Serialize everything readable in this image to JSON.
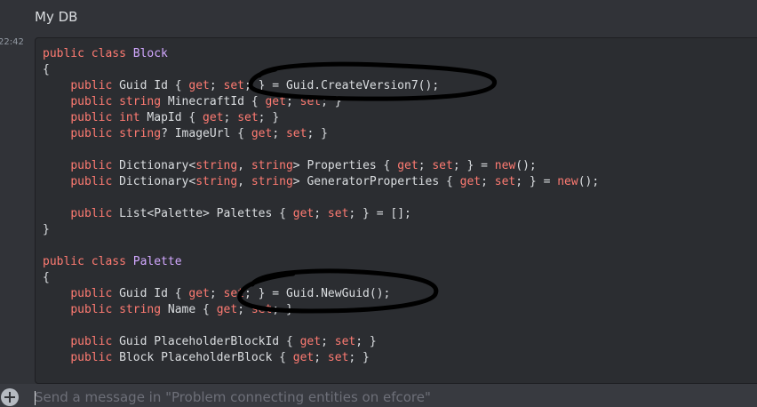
{
  "header": {
    "title": "My DB"
  },
  "message": {
    "timestamp": "22:42",
    "code_lines": [
      [
        {
          "t": "kw",
          "v": "public class "
        },
        {
          "t": "cls",
          "v": "Block"
        }
      ],
      [
        {
          "t": "plain",
          "v": "{"
        }
      ],
      [
        {
          "t": "plain",
          "v": "    "
        },
        {
          "t": "kw",
          "v": "public"
        },
        {
          "t": "plain",
          "v": " Guid Id { "
        },
        {
          "t": "kw",
          "v": "get"
        },
        {
          "t": "plain",
          "v": "; "
        },
        {
          "t": "kw",
          "v": "set"
        },
        {
          "t": "plain",
          "v": "; } = Guid.CreateVersion7();"
        }
      ],
      [
        {
          "t": "plain",
          "v": "    "
        },
        {
          "t": "kw",
          "v": "public"
        },
        {
          "t": "plain",
          "v": " "
        },
        {
          "t": "kw",
          "v": "string"
        },
        {
          "t": "plain",
          "v": " MinecraftId { "
        },
        {
          "t": "kw",
          "v": "get"
        },
        {
          "t": "plain",
          "v": "; "
        },
        {
          "t": "kw",
          "v": "set"
        },
        {
          "t": "plain",
          "v": "; }"
        }
      ],
      [
        {
          "t": "plain",
          "v": "    "
        },
        {
          "t": "kw",
          "v": "public"
        },
        {
          "t": "plain",
          "v": " "
        },
        {
          "t": "kw",
          "v": "int"
        },
        {
          "t": "plain",
          "v": " MapId { "
        },
        {
          "t": "kw",
          "v": "get"
        },
        {
          "t": "plain",
          "v": "; "
        },
        {
          "t": "kw",
          "v": "set"
        },
        {
          "t": "plain",
          "v": "; }"
        }
      ],
      [
        {
          "t": "plain",
          "v": "    "
        },
        {
          "t": "kw",
          "v": "public"
        },
        {
          "t": "plain",
          "v": " "
        },
        {
          "t": "kw",
          "v": "string"
        },
        {
          "t": "plain",
          "v": "? ImageUrl { "
        },
        {
          "t": "kw",
          "v": "get"
        },
        {
          "t": "plain",
          "v": "; "
        },
        {
          "t": "kw",
          "v": "set"
        },
        {
          "t": "plain",
          "v": "; }"
        }
      ],
      [
        {
          "t": "plain",
          "v": ""
        }
      ],
      [
        {
          "t": "plain",
          "v": "    "
        },
        {
          "t": "kw",
          "v": "public"
        },
        {
          "t": "plain",
          "v": " Dictionary<"
        },
        {
          "t": "kw",
          "v": "string"
        },
        {
          "t": "plain",
          "v": ", "
        },
        {
          "t": "kw",
          "v": "string"
        },
        {
          "t": "plain",
          "v": "> Properties { "
        },
        {
          "t": "kw",
          "v": "get"
        },
        {
          "t": "plain",
          "v": "; "
        },
        {
          "t": "kw",
          "v": "set"
        },
        {
          "t": "plain",
          "v": "; } = "
        },
        {
          "t": "kw",
          "v": "new"
        },
        {
          "t": "plain",
          "v": "();"
        }
      ],
      [
        {
          "t": "plain",
          "v": "    "
        },
        {
          "t": "kw",
          "v": "public"
        },
        {
          "t": "plain",
          "v": " Dictionary<"
        },
        {
          "t": "kw",
          "v": "string"
        },
        {
          "t": "plain",
          "v": ", "
        },
        {
          "t": "kw",
          "v": "string"
        },
        {
          "t": "plain",
          "v": "> GeneratorProperties { "
        },
        {
          "t": "kw",
          "v": "get"
        },
        {
          "t": "plain",
          "v": "; "
        },
        {
          "t": "kw",
          "v": "set"
        },
        {
          "t": "plain",
          "v": "; } = "
        },
        {
          "t": "kw",
          "v": "new"
        },
        {
          "t": "plain",
          "v": "();"
        }
      ],
      [
        {
          "t": "plain",
          "v": ""
        }
      ],
      [
        {
          "t": "plain",
          "v": "    "
        },
        {
          "t": "kw",
          "v": "public"
        },
        {
          "t": "plain",
          "v": " List<Palette> Palettes { "
        },
        {
          "t": "kw",
          "v": "get"
        },
        {
          "t": "plain",
          "v": "; "
        },
        {
          "t": "kw",
          "v": "set"
        },
        {
          "t": "plain",
          "v": "; } = [];"
        }
      ],
      [
        {
          "t": "plain",
          "v": "}"
        }
      ],
      [
        {
          "t": "plain",
          "v": ""
        }
      ],
      [
        {
          "t": "kw",
          "v": "public class "
        },
        {
          "t": "cls",
          "v": "Palette"
        }
      ],
      [
        {
          "t": "plain",
          "v": "{"
        }
      ],
      [
        {
          "t": "plain",
          "v": "    "
        },
        {
          "t": "kw",
          "v": "public"
        },
        {
          "t": "plain",
          "v": " Guid Id { "
        },
        {
          "t": "kw",
          "v": "get"
        },
        {
          "t": "plain",
          "v": "; "
        },
        {
          "t": "kw",
          "v": "set"
        },
        {
          "t": "plain",
          "v": "; } = Guid.NewGuid();"
        }
      ],
      [
        {
          "t": "plain",
          "v": "    "
        },
        {
          "t": "kw",
          "v": "public"
        },
        {
          "t": "plain",
          "v": " "
        },
        {
          "t": "kw",
          "v": "string"
        },
        {
          "t": "plain",
          "v": " Name { "
        },
        {
          "t": "kw",
          "v": "get"
        },
        {
          "t": "plain",
          "v": "; "
        },
        {
          "t": "kw",
          "v": "set"
        },
        {
          "t": "plain",
          "v": "; }"
        }
      ],
      [
        {
          "t": "plain",
          "v": ""
        }
      ],
      [
        {
          "t": "plain",
          "v": "    "
        },
        {
          "t": "kw",
          "v": "public"
        },
        {
          "t": "plain",
          "v": " Guid PlaceholderBlockId { "
        },
        {
          "t": "kw",
          "v": "get"
        },
        {
          "t": "plain",
          "v": "; "
        },
        {
          "t": "kw",
          "v": "set"
        },
        {
          "t": "plain",
          "v": "; }"
        }
      ],
      [
        {
          "t": "plain",
          "v": "    "
        },
        {
          "t": "kw",
          "v": "public"
        },
        {
          "t": "plain",
          "v": " Block PlaceholderBlock { "
        },
        {
          "t": "kw",
          "v": "get"
        },
        {
          "t": "plain",
          "v": "; "
        },
        {
          "t": "kw",
          "v": "set"
        },
        {
          "t": "plain",
          "v": "; }"
        }
      ]
    ]
  },
  "composer": {
    "placeholder": "Send a message in \"Problem connecting entities on efcore\"",
    "add_icon": "plus-circle-icon"
  },
  "colors": {
    "background": "#313338",
    "code_background": "#2b2d31",
    "keyword": "#ff7b72",
    "class_name": "#d2a8ff",
    "text": "#dbdee1",
    "annotation": "#000000"
  }
}
